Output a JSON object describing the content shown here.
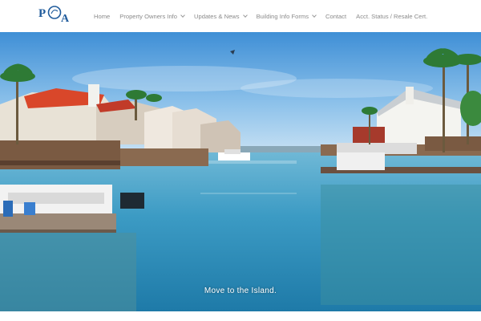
{
  "logo": {
    "text": "POA",
    "color": "#1f5b9c"
  },
  "nav": {
    "items": [
      {
        "label": "Home",
        "has_dropdown": false
      },
      {
        "label": "Property Owners Info",
        "has_dropdown": true
      },
      {
        "label": "Updates & News",
        "has_dropdown": true
      },
      {
        "label": "Building Info Forms",
        "has_dropdown": true
      },
      {
        "label": "Contact",
        "has_dropdown": false
      },
      {
        "label": "Acct. Status / Resale Cert.",
        "has_dropdown": false
      }
    ]
  },
  "slider": {
    "caption": "Move to the Island.",
    "slide_count": 4,
    "active_index": 0
  }
}
